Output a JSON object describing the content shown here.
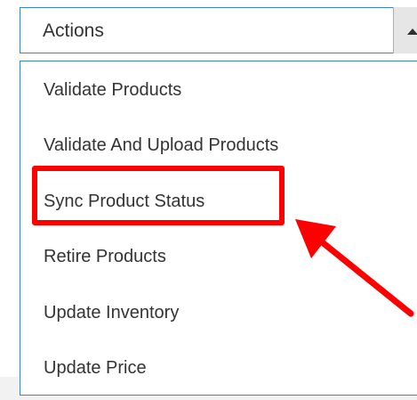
{
  "dropdown": {
    "label": "Actions",
    "arrow_icon": "caret-up-icon"
  },
  "menu": {
    "items": [
      {
        "label": "Validate Products"
      },
      {
        "label": "Validate And Upload Products"
      },
      {
        "label": "Sync Product Status"
      },
      {
        "label": "Retire Products"
      },
      {
        "label": "Update Inventory"
      },
      {
        "label": "Update Price"
      }
    ]
  },
  "annotation": {
    "highlight_color": "#ff0000",
    "highlighted_item": "Sync Product Status"
  },
  "colors": {
    "border_accent": "#3d85c6",
    "text": "#333333"
  }
}
